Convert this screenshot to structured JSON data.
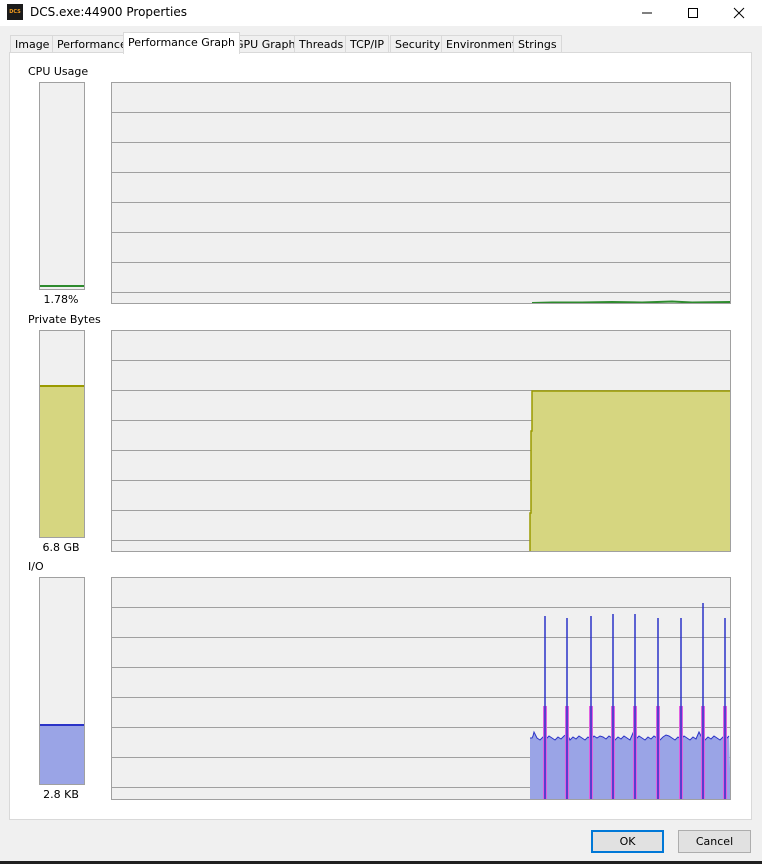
{
  "window": {
    "title": "DCS.exe:44900 Properties",
    "app_icon_text": "DCS"
  },
  "tabs": [
    "Image",
    "Performance",
    "Performance Graph",
    "GPU Graph",
    "Threads",
    "TCP/IP",
    "Security",
    "Environment",
    "Strings"
  ],
  "active_tab": "Performance Graph",
  "sections": {
    "cpu": {
      "label": "CPU Usage",
      "value": "1.78%",
      "fraction": 0.0178
    },
    "private_bytes": {
      "label": "Private Bytes",
      "value": "6.8 GB",
      "fraction": 0.74
    },
    "io": {
      "label": "I/O",
      "value": "2.8  KB",
      "fraction": 0.29
    }
  },
  "buttons": {
    "ok": "OK",
    "cancel": "Cancel"
  },
  "colors": {
    "cpu": "#2e8b2e",
    "private_bytes_fill": "#d6d680",
    "private_bytes_line": "#9a9a00",
    "io_fill": "#9aa4e6",
    "io_line": "#2b33c7",
    "io_spike": "#e060e0"
  }
}
